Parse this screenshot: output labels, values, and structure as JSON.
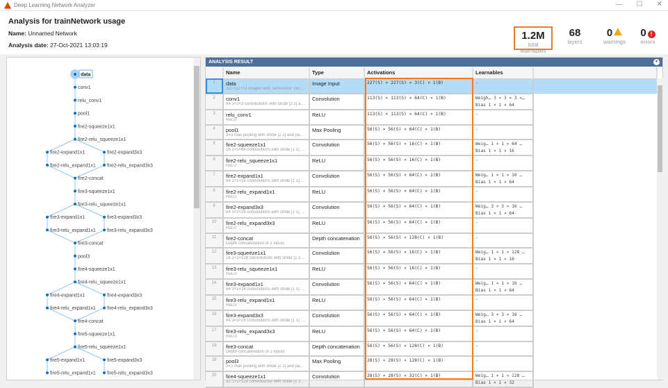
{
  "window": {
    "title": "Deep Learning Network Analyzer",
    "controls": [
      "—",
      "☐",
      "✕"
    ]
  },
  "header": {
    "title": "Analysis for trainNetwork usage",
    "name_label": "Name:",
    "name_value": "Unnamed Network",
    "date_label": "Analysis date:",
    "date_value": "27-Oct-2021 13:03:19"
  },
  "stats": {
    "learnables": {
      "value": "1.2M",
      "label": "total learnables"
    },
    "layers": {
      "value": "68",
      "label": "layers"
    },
    "warnings": {
      "value": "0",
      "label": "warnings",
      "icon": "warning-icon"
    },
    "errors": {
      "value": "0",
      "label": "errors",
      "icon": "error-icon"
    }
  },
  "colors": {
    "accent": "#f07a22",
    "node": "#0b6fc6",
    "edge": "#8cc4ec",
    "bar": "#4e6f9a",
    "selection": "#b3dcf9"
  },
  "graph": {
    "selected": "data",
    "nodes": [
      "data",
      "conv1",
      "relu_conv1",
      "pool1",
      "fire2-squeeze1x1",
      "fire2-relu_squeeze1x1",
      "fire2-expand1x1",
      "fire2-expand3x3",
      "fire2-relu_expand1x1",
      "fire2-relu_expand3x3",
      "fire2-concat",
      "fire3-squeeze1x1",
      "fire3-relu_squeeze1x1",
      "fire3-expand1x1",
      "fire3-expand3x3",
      "fire3-relu_expand1x1",
      "fire3-relu_expand3x3",
      "fire3-concat",
      "pool3",
      "fire4-squeeze1x1",
      "fire4-relu_squeeze1x1",
      "fire4-expand1x1",
      "fire4-expand3x3",
      "fire4-relu_expand1x1",
      "fire4-relu_expand3x3",
      "fire4-concat",
      "fire5-squeeze1x1",
      "fire5-relu_squeeze1x1",
      "fire5-expand1x1",
      "fire5-expand3x3",
      "fire5-relu_expand1x1",
      "fire5-relu_expand3x3"
    ]
  },
  "result": {
    "title": "ANALYSIS RESULT",
    "columns": [
      "",
      "Name",
      "Type",
      "Activations",
      "Learnables"
    ],
    "rows": [
      {
        "n": "1",
        "name": "data",
        "desc": "227×227×3 images with 'zerocenter' nor…",
        "type": "Image Input",
        "act": "227(S) × 227(S) × 3(C) × 1(B)",
        "l1": "-",
        "l2": ""
      },
      {
        "n": "2",
        "name": "conv1",
        "desc": "64 3×3×3 convolutions with stride [2 2] a…",
        "type": "Convolution",
        "act": "113(S) × 113(S) × 64(C) × 1(B)",
        "l1": "Weigh…  3 × 3 × 3 ×…",
        "l2": "Bias    1 × 1 × 64"
      },
      {
        "n": "3",
        "name": "relu_conv1",
        "desc": "ReLU",
        "type": "ReLU",
        "act": "113(S) × 113(S) × 64(C) × 1(B)",
        "l1": "-",
        "l2": ""
      },
      {
        "n": "4",
        "name": "pool1",
        "desc": "3×3 max pooling with stride [2 2] and pa…",
        "type": "Max Pooling",
        "act": "56(S) × 56(S) × 64(C) × 1(B)",
        "l1": "-",
        "l2": ""
      },
      {
        "n": "5",
        "name": "fire2-squeeze1x1",
        "desc": "16 1×1×64 convolutions with stride [1 1] …",
        "type": "Convolution",
        "act": "56(S) × 56(S) × 16(C) × 1(B)",
        "l1": "Weig…   1 × 1 × 64 …",
        "l2": "Bias    1 × 1 × 16"
      },
      {
        "n": "6",
        "name": "fire2-relu_squeeze1x1",
        "desc": "ReLU",
        "type": "ReLU",
        "act": "56(S) × 56(S) × 16(C) × 1(B)",
        "l1": "-",
        "l2": ""
      },
      {
        "n": "7",
        "name": "fire2-expand1x1",
        "desc": "64 1×1×16 convolutions with stride [1 1] …",
        "type": "Convolution",
        "act": "56(S) × 56(S) × 64(C) × 1(B)",
        "l1": "Weig…   1 × 1 × 16 …",
        "l2": "Bias    1 × 1 × 64"
      },
      {
        "n": "8",
        "name": "fire2-relu_expand1x1",
        "desc": "ReLU",
        "type": "ReLU",
        "act": "56(S) × 56(S) × 64(C) × 1(B)",
        "l1": "-",
        "l2": ""
      },
      {
        "n": "9",
        "name": "fire2-expand3x3",
        "desc": "64 3×3×16 convolutions with stride [1 1] …",
        "type": "Convolution",
        "act": "56(S) × 56(S) × 64(C) × 1(B)",
        "l1": "Weig…   3 × 3 × 16 …",
        "l2": "Bias    1 × 1 × 64"
      },
      {
        "n": "10",
        "name": "fire2-relu_expand3x3",
        "desc": "ReLU",
        "type": "ReLU",
        "act": "56(S) × 56(S) × 64(C) × 1(B)",
        "l1": "-",
        "l2": ""
      },
      {
        "n": "11",
        "name": "fire2-concat",
        "desc": "Depth concatenation of 2 inputs",
        "type": "Depth concatenation",
        "act": "56(S) × 56(S) × 128(C) × 1(B)",
        "l1": "-",
        "l2": ""
      },
      {
        "n": "12",
        "name": "fire3-squeeze1x1",
        "desc": "16 1×1×128 convolutions with stride [1 1…",
        "type": "Convolution",
        "act": "56(S) × 56(S) × 16(C) × 1(B)",
        "l1": "Weig…  1 × 1 × 128 …",
        "l2": "Bias    1 × 1 × 16"
      },
      {
        "n": "13",
        "name": "fire3-relu_squeeze1x1",
        "desc": "ReLU",
        "type": "ReLU",
        "act": "56(S) × 56(S) × 16(C) × 1(B)",
        "l1": "-",
        "l2": ""
      },
      {
        "n": "14",
        "name": "fire3-expand1x1",
        "desc": "64 1×1×16 convolutions with stride [1 1] …",
        "type": "Convolution",
        "act": "56(S) × 56(S) × 64(C) × 1(B)",
        "l1": "Weig…   1 × 1 × 16 …",
        "l2": "Bias    1 × 1 × 64"
      },
      {
        "n": "15",
        "name": "fire3-relu_expand1x1",
        "desc": "ReLU",
        "type": "ReLU",
        "act": "56(S) × 56(S) × 64(C) × 1(B)",
        "l1": "-",
        "l2": ""
      },
      {
        "n": "16",
        "name": "fire3-expand3x3",
        "desc": "64 3×3×16 convolutions with stride [1 1] …",
        "type": "Convolution",
        "act": "56(S) × 56(S) × 64(C) × 1(B)",
        "l1": "Weig…   3 × 3 × 16 …",
        "l2": "Bias    1 × 1 × 64"
      },
      {
        "n": "17",
        "name": "fire3-relu_expand3x3",
        "desc": "ReLU",
        "type": "ReLU",
        "act": "56(S) × 56(S) × 64(C) × 1(B)",
        "l1": "-",
        "l2": ""
      },
      {
        "n": "18",
        "name": "fire3-concat",
        "desc": "Depth concatenation of 2 inputs",
        "type": "Depth concatenation",
        "act": "56(S) × 56(S) × 128(C) × 1(B)",
        "l1": "-",
        "l2": ""
      },
      {
        "n": "19",
        "name": "pool3",
        "desc": "3×3 max pooling with stride [2 2] and pa…",
        "type": "Max Pooling",
        "act": "28(S) × 28(S) × 128(C) × 1(B)",
        "l1": "-",
        "l2": ""
      },
      {
        "n": "20",
        "name": "fire4-squeeze1x1",
        "desc": "32 1×1×128 convolutions with stride [1 1…",
        "type": "Convolution",
        "act": "28(S) × 28(S) × 32(C) × 1(B)",
        "l1": "Weig…  1 × 1 × 128 …",
        "l2": "Bias    1 × 1 × 32"
      }
    ]
  }
}
